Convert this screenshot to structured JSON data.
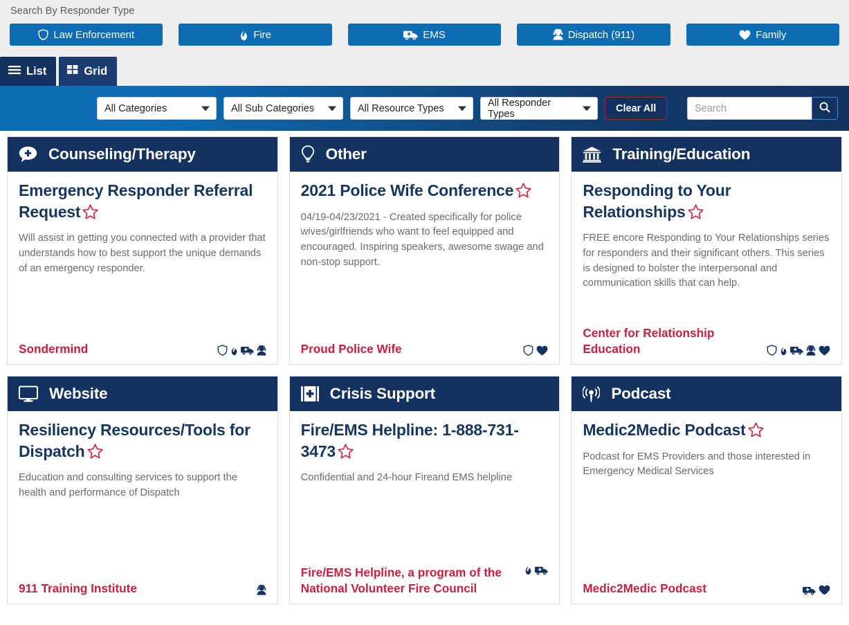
{
  "responder_search": {
    "label": "Search By Responder Type",
    "buttons": [
      {
        "label": "Law Enforcement",
        "icon": "shield-icon"
      },
      {
        "label": "Fire",
        "icon": "flame-icon"
      },
      {
        "label": "EMS",
        "icon": "ambulance-icon"
      },
      {
        "label": "Dispatch (911)",
        "icon": "headset-person-icon"
      },
      {
        "label": "Family",
        "icon": "heart-icon"
      }
    ],
    "accent_color": "#0e6cb4"
  },
  "view_tabs": [
    {
      "label": "List",
      "icon": "hamburger-icon",
      "active": true
    },
    {
      "label": "Grid",
      "icon": "grid-icon",
      "active": false
    }
  ],
  "filters": {
    "categories": "All Categories",
    "sub_categories": "All Sub Categories",
    "resource_types": "All Resource Types",
    "responder_types": "All Responder Types",
    "clear_all": "Clear All",
    "search_placeholder": "Search",
    "search_value": "",
    "search_icon": "magnifier-icon",
    "bar_color_start": "#0d6cb4",
    "bar_color_end": "#143260"
  },
  "cards": [
    {
      "category": "Counseling/Therapy",
      "category_icon": "speech-bubble-plus-icon",
      "title": "Emergency Responder Referral Request",
      "description": "Will assist in getting you connected with a provider that understands how to best support the unique demands of an emergency responder.",
      "organization": "Sondermind",
      "badges": [
        "shield-icon",
        "flame-icon",
        "ambulance-icon",
        "headset-person-icon"
      ]
    },
    {
      "category": "Other",
      "category_icon": "lightbulb-icon",
      "title": "2021 Police Wife Conference",
      "description": "04/19-04/23/2021 - Created specifically for police wives/girlfriends who want to feel equipped and encouraged. Inspiring speakers, awesome swage and non-stop support.",
      "organization": "Proud Police Wife",
      "badges": [
        "shield-icon",
        "heart-icon"
      ]
    },
    {
      "category": "Training/Education",
      "category_icon": "institution-icon",
      "title": "Responding to Your Relationships",
      "description": "FREE encore Responding to Your Relationships series for responders and their significant others. This series is designed to bolster the interpersonal and communication skills that can help.",
      "organization": "Center for Relationship Education",
      "badges": [
        "shield-icon",
        "flame-icon",
        "ambulance-icon",
        "headset-person-icon",
        "heart-icon"
      ]
    },
    {
      "category": "Website",
      "category_icon": "monitor-icon",
      "title": "Resiliency Resources/Tools for Dispatch",
      "description": "Education and consulting services to support the health and performance of Dispatch",
      "organization": "911 Training Institute",
      "badges": [
        "headset-person-icon"
      ]
    },
    {
      "category": "Crisis Support",
      "category_icon": "first-aid-book-icon",
      "title": "Fire/EMS Helpline: 1-888-731-3473",
      "description": "Confidential and 24-hour Fireand EMS helpline",
      "organization": "Fire/EMS Helpline, a program of the National Volunteer Fire Council",
      "badges": [
        "flame-icon",
        "ambulance-icon"
      ]
    },
    {
      "category": "Podcast",
      "category_icon": "podcast-icon",
      "title": "Medic2Medic Podcast",
      "description": "Podcast for EMS Providers and those interested in Emergency Medical Services",
      "organization": "Medic2Medic Podcast",
      "badges": [
        "ambulance-icon",
        "heart-icon"
      ]
    }
  ],
  "colors": {
    "navy": "#143260",
    "blue": "#0e6cb4",
    "red": "#c8203f",
    "star_outline": "#d6213c"
  }
}
